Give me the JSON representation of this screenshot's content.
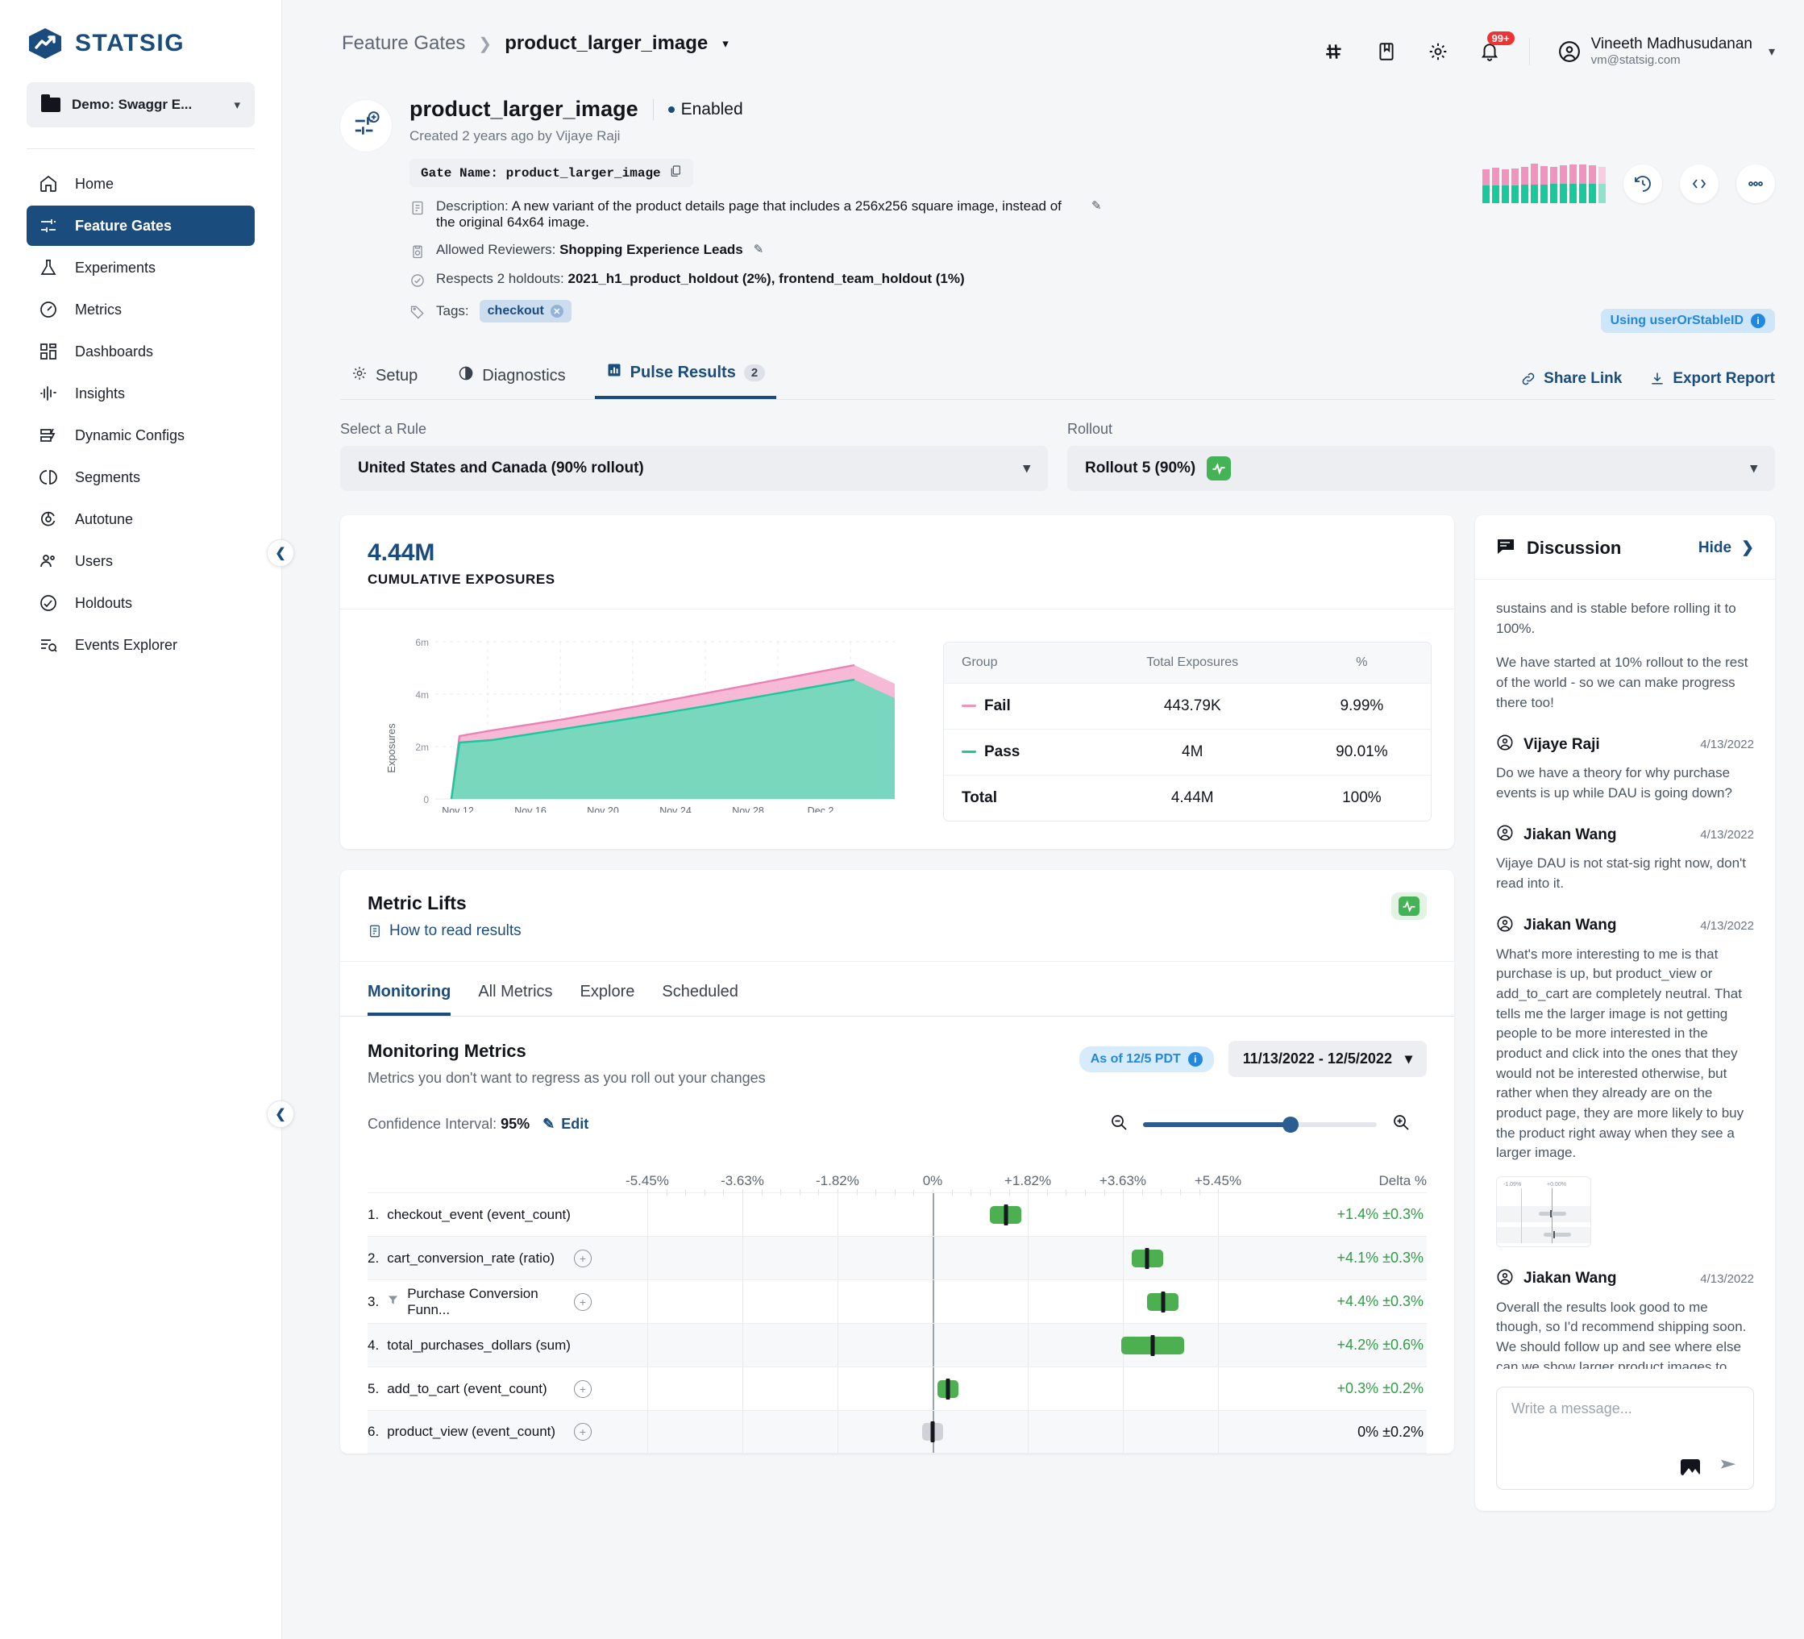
{
  "brand": {
    "name": "STATSIG",
    "color": "#194b7d"
  },
  "workspace": {
    "name": "Demo: Swaggr E..."
  },
  "sidebar": {
    "items": [
      {
        "label": "Home",
        "icon": "home-icon"
      },
      {
        "label": "Feature Gates",
        "icon": "sliders-icon"
      },
      {
        "label": "Experiments",
        "icon": "flask-icon"
      },
      {
        "label": "Metrics",
        "icon": "gauge-icon"
      },
      {
        "label": "Dashboards",
        "icon": "grid-icon"
      },
      {
        "label": "Insights",
        "icon": "waveform-icon"
      },
      {
        "label": "Dynamic Configs",
        "icon": "config-icon"
      },
      {
        "label": "Segments",
        "icon": "pie-icon"
      },
      {
        "label": "Autotune",
        "icon": "target-icon"
      },
      {
        "label": "Users",
        "icon": "users-icon"
      },
      {
        "label": "Holdouts",
        "icon": "holdout-icon"
      },
      {
        "label": "Events Explorer",
        "icon": "events-icon"
      }
    ]
  },
  "topbar": {
    "breadcrumb_root": "Feature Gates",
    "breadcrumb_current": "product_larger_image",
    "notification_count": "99+",
    "user_name": "Vineeth Madhusudanan",
    "user_email": "vm@statsig.com"
  },
  "gate": {
    "title": "product_larger_image",
    "status": "Enabled",
    "created": "Created 2 years ago by Vijaye Raji",
    "gate_name_chip": "Gate Name: product_larger_image",
    "description_label": "Description:",
    "description": "A new variant of the product details page that includes a 256x256 square image, instead of the original 64x64 image.",
    "reviewers_label": "Allowed Reviewers:",
    "reviewers": "Shopping Experience Leads",
    "holdouts_label": "Respects 2 holdouts:",
    "holdouts": "2021_h1_product_holdout (2%), frontend_team_holdout (1%)",
    "tags_label": "Tags:",
    "tag": "checkout",
    "id_badge": "Using userOrStableID"
  },
  "tabs": {
    "items": [
      {
        "label": "Setup",
        "icon": "gear-icon",
        "count": ""
      },
      {
        "label": "Diagnostics",
        "icon": "diagnostics-icon",
        "count": ""
      },
      {
        "label": "Pulse Results",
        "icon": "chart-icon",
        "count": "2"
      }
    ],
    "share_link": "Share Link",
    "export_report": "Export Report"
  },
  "selectors": {
    "rule_label": "Select a Rule",
    "rule_value": "United States and Canada (90% rollout)",
    "rollout_label": "Rollout",
    "rollout_value": "Rollout 5 (90%)"
  },
  "exposures": {
    "total": "4.44M",
    "caption": "CUMULATIVE EXPOSURES",
    "table_headers": [
      "Group",
      "Total Exposures",
      "%"
    ],
    "rows": [
      {
        "group": "Fail",
        "exposures": "443.79K",
        "pct": "9.99%",
        "color": "#f093bd"
      },
      {
        "group": "Pass",
        "exposures": "4M",
        "pct": "90.01%",
        "color": "#17c99b"
      },
      {
        "group": "Total",
        "exposures": "4.44M",
        "pct": "100%",
        "color": ""
      }
    ]
  },
  "metric_lifts": {
    "title": "Metric Lifts",
    "how_to_link": "How to read results",
    "subtabs": [
      "Monitoring",
      "All Metrics",
      "Explore",
      "Scheduled"
    ],
    "section_title": "Monitoring Metrics",
    "section_sub": "Metrics you don't want to regress as you roll out your changes",
    "as_of": "As of 12/5 PDT",
    "date_range": "11/13/2022 - 12/5/2022",
    "ci_label": "Confidence Interval:",
    "ci_value": "95%",
    "ci_edit": "Edit",
    "delta_header": "Delta %"
  },
  "chart_data": [
    {
      "type": "area",
      "title": "Cumulative Exposures",
      "xlabel": "",
      "ylabel": "Exposures",
      "x": [
        "Nov 12",
        "Nov 16",
        "Nov 20",
        "Nov 24",
        "Nov 28",
        "Dec 2"
      ],
      "xticklabels": [
        "Nov 12",
        "Nov 16",
        "Nov 20",
        "Nov 24",
        "Nov 28",
        "Dec 2"
      ],
      "yticklabels": [
        "0",
        "2m",
        "4m",
        "6m"
      ],
      "ylim": [
        0,
        6000000
      ],
      "grid": true,
      "legend_position": "right-table",
      "series": [
        {
          "name": "Pass",
          "color": "#3fd0a8",
          "values": [
            0,
            2150000,
            2450000,
            2750000,
            3100000,
            3450000,
            4000000
          ]
        },
        {
          "name": "Fail",
          "color": "#f2a0c8",
          "values": [
            0,
            2400000,
            2700000,
            3020000,
            3400000,
            3800000,
            4440000
          ]
        }
      ]
    },
    {
      "type": "bar",
      "title": "Metric Lifts Confidence Intervals",
      "xlabel": "Delta %",
      "ylabel": "",
      "xticklabels": [
        "-5.45%",
        "-3.63%",
        "-1.82%",
        "0%",
        "+1.82%",
        "+3.63%",
        "+5.45%"
      ],
      "xlim": [
        -6.36,
        6.36
      ],
      "grid": true,
      "categories": [
        "1. checkout_event (event_count)",
        "2. cart_conversion_rate (ratio)",
        "3. Purchase Conversion Funn...",
        "4. total_purchases_dollars (sum)",
        "5. add_to_cart (event_count)",
        "6. product_view (event_count)"
      ],
      "values": [
        1.4,
        4.1,
        4.4,
        4.2,
        0.3,
        0.0
      ],
      "errors": [
        0.3,
        0.3,
        0.3,
        0.6,
        0.2,
        0.2
      ],
      "labels": [
        "+1.4% ±0.3%",
        "+4.1% ±0.3%",
        "+4.4% ±0.3%",
        "+4.2% ±0.6%",
        "+0.3% ±0.2%",
        "0% ±0.2%"
      ]
    }
  ],
  "metrics_rows": [
    {
      "num": "1.",
      "name": "checkout_event (event_count)",
      "has_plus": false,
      "has_funnel": false,
      "value": 1.4,
      "err": 0.3,
      "delta": "+1.4% ±0.3%",
      "sig": "pos"
    },
    {
      "num": "2.",
      "name": "cart_conversion_rate (ratio)",
      "has_plus": true,
      "has_funnel": false,
      "value": 4.1,
      "err": 0.3,
      "delta": "+4.1% ±0.3%",
      "sig": "pos"
    },
    {
      "num": "3.",
      "name": "Purchase Conversion Funn...",
      "has_plus": true,
      "has_funnel": true,
      "value": 4.4,
      "err": 0.3,
      "delta": "+4.4% ±0.3%",
      "sig": "pos"
    },
    {
      "num": "4.",
      "name": "total_purchases_dollars (sum)",
      "has_plus": false,
      "has_funnel": false,
      "value": 4.2,
      "err": 0.6,
      "delta": "+4.2% ±0.6%",
      "sig": "pos"
    },
    {
      "num": "5.",
      "name": "add_to_cart (event_count)",
      "has_plus": true,
      "has_funnel": false,
      "value": 0.3,
      "err": 0.2,
      "delta": "+0.3% ±0.2%",
      "sig": "pos"
    },
    {
      "num": "6.",
      "name": "product_view (event_count)",
      "has_plus": true,
      "has_funnel": false,
      "value": 0.0,
      "err": 0.2,
      "delta": "0% ±0.2%",
      "sig": "neu"
    }
  ],
  "discussion": {
    "title": "Discussion",
    "hide": "Hide",
    "partial_message": "sustains and is stable before rolling it to 100%.",
    "partial_message2": "We have started at 10% rollout to the rest of the world - so we can make progress there too!",
    "messages": [
      {
        "author": "Vijaye Raji",
        "date": "4/13/2022",
        "text": "Do we have a theory for why purchase events is up while DAU is going down?",
        "has_thumb": false
      },
      {
        "author": "Jiakan Wang",
        "date": "4/13/2022",
        "text": "Vijaye DAU is not stat-sig right now, don't read into it.",
        "has_thumb": false
      },
      {
        "author": "Jiakan Wang",
        "date": "4/13/2022",
        "text": "What's more interesting to me is that purchase is up, but product_view or add_to_cart are completely neutral. That tells me the larger image is not getting people to be more interested in the product and click into the ones that they would not be interested otherwise, but rather when they already are on the product page, they are more likely to buy the product right away when they see a larger image.",
        "has_thumb": true,
        "thumb_label_left": "-1.09%",
        "thumb_label_right": "+0.00%"
      },
      {
        "author": "Jiakan Wang",
        "date": "4/13/2022",
        "text": "Overall the results look good to me though, so I'd recommend shipping soon. We should follow up and see where else can we show larger product images to improve the CTRs.",
        "has_thumb": false
      }
    ],
    "compose_placeholder": "Write a message..."
  }
}
